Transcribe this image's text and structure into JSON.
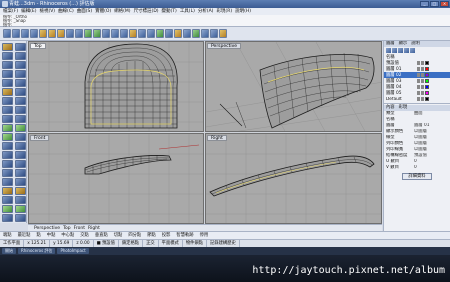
{
  "window": {
    "title": "青蛙...3dm - Rhinoceros (...) 評估版",
    "buttons": [
      "_",
      "□",
      "×"
    ]
  },
  "menubar": {
    "items": [
      "檔案(F)",
      "編輯(E)",
      "檢視(V)",
      "曲線(C)",
      "曲面(S)",
      "實體(O)",
      "網格(M)",
      "尺寸標註(D)",
      "變動(T)",
      "工具(L)",
      "分析(A)",
      "彩現(R)",
      "說明(H)"
    ]
  },
  "command": {
    "lines": [
      "指令: _Ortho",
      "指令: _Snap",
      "指令:"
    ]
  },
  "viewports": {
    "top_label": "Top",
    "perspective_label": "Perspective",
    "front_label": "Front",
    "right_label": "Right"
  },
  "viewport_tabs": [
    "Perspective",
    "Top",
    "Front",
    "Right"
  ],
  "osnap": {
    "items": [
      "端點",
      "最近點",
      "點",
      "中點",
      "中心點",
      "交點",
      "垂直點",
      "切點",
      "四分點",
      "節點",
      "投影",
      "智慧軌跡",
      "停用"
    ]
  },
  "statusbar": {
    "cells": [
      "工作平面",
      "x 125.21",
      "y 15.69",
      "z 0.00",
      "■ 預設值",
      "鎖定格點",
      "正交",
      "平面模式",
      "物件鎖點",
      "記錄建構歷史"
    ]
  },
  "taskbar": {
    "buttons": [
      "開始",
      "Rhinoceros 評估",
      "PhotoImpact"
    ]
  },
  "watermark": "http://jaytouch.pixnet.net/album",
  "layers": {
    "tabs": [
      "圖層",
      "顯示",
      "說明"
    ],
    "header": "名稱",
    "rows": [
      {
        "name": "預設值",
        "color": "#000000"
      },
      {
        "name": "圖層 01",
        "color": "#ff0000"
      },
      {
        "name": "圖層 02",
        "color": "#7f00ff"
      },
      {
        "name": "圖層 03",
        "color": "#00ff00"
      },
      {
        "name": "圖層 04",
        "color": "#0000ff"
      },
      {
        "name": "圖層 05",
        "color": "#ff00ff"
      },
      {
        "name": "Default",
        "color": "#000000"
      }
    ],
    "selected_index": 2
  },
  "properties": {
    "tabs": [
      "內容",
      "彩現"
    ],
    "rows": [
      {
        "key": "類型",
        "value": "曲面"
      },
      {
        "key": "名稱",
        "value": ""
      },
      {
        "key": "圖層",
        "value": "圖層 01"
      },
      {
        "key": "顯示顏色",
        "value": "以圖層"
      },
      {
        "key": "線型",
        "value": "以圖層"
      },
      {
        "key": "列印顏色",
        "value": "以圖層"
      },
      {
        "key": "列印線寬",
        "value": "以圖層"
      },
      {
        "key": "結構線密度",
        "value": "預設值"
      },
      {
        "key": "U 數目",
        "value": "0"
      },
      {
        "key": "V 數目",
        "value": "0"
      }
    ],
    "button_label": "詳細資料"
  },
  "colors": {
    "viewport_bg": "#a9a9a9",
    "mesh_stroke": "#1c1c1c",
    "highlight": "#e8d86a"
  }
}
